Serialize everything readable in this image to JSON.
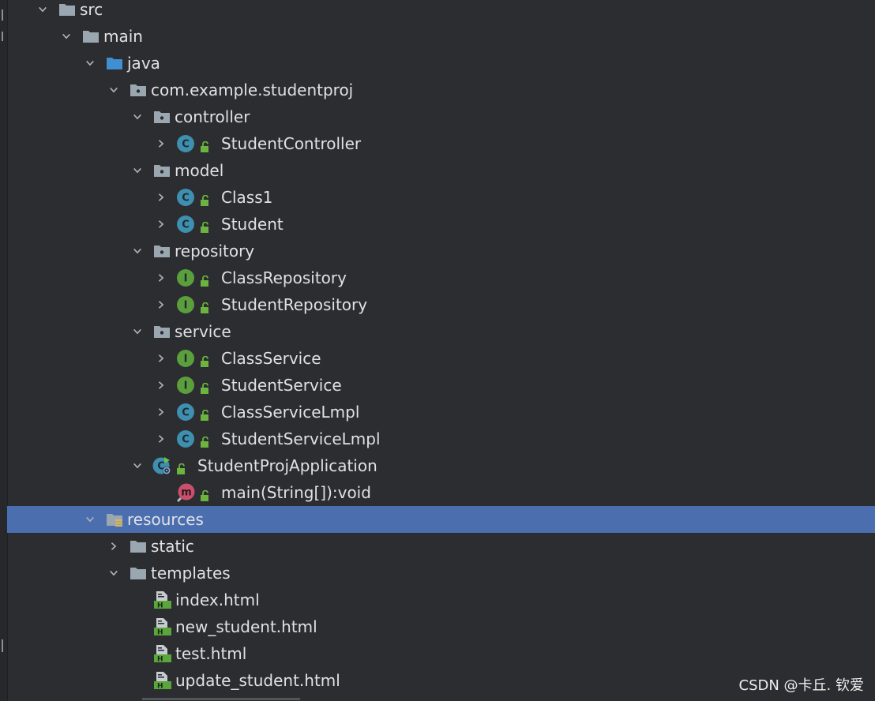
{
  "tree": {
    "nodes": [
      {
        "label": "src",
        "type": "folder",
        "expanded": true
      },
      {
        "label": "main",
        "type": "folder",
        "expanded": true
      },
      {
        "label": "java",
        "type": "source-folder",
        "expanded": true
      },
      {
        "label": "com.example.studentproj",
        "type": "package",
        "expanded": true
      },
      {
        "label": "controller",
        "type": "package",
        "expanded": true
      },
      {
        "label": "StudentController",
        "type": "class",
        "expanded": false
      },
      {
        "label": "model",
        "type": "package",
        "expanded": true
      },
      {
        "label": "Class1",
        "type": "class",
        "expanded": false
      },
      {
        "label": "Student",
        "type": "class",
        "expanded": false
      },
      {
        "label": "repository",
        "type": "package",
        "expanded": true
      },
      {
        "label": "ClassRepository",
        "type": "interface",
        "expanded": false
      },
      {
        "label": "StudentRepository",
        "type": "interface",
        "expanded": false
      },
      {
        "label": "service",
        "type": "package",
        "expanded": true
      },
      {
        "label": "ClassService",
        "type": "interface",
        "expanded": false
      },
      {
        "label": "StudentService",
        "type": "interface",
        "expanded": false
      },
      {
        "label": "ClassServiceLmpl",
        "type": "class",
        "expanded": false
      },
      {
        "label": "StudentServiceLmpl",
        "type": "class",
        "expanded": false
      },
      {
        "label": "StudentProjApplication",
        "type": "spring-app",
        "expanded": true
      },
      {
        "label": "main(String[]):void",
        "type": "method"
      },
      {
        "label": "resources",
        "type": "resources-folder",
        "expanded": true,
        "selected": true
      },
      {
        "label": "static",
        "type": "folder",
        "expanded": false
      },
      {
        "label": "templates",
        "type": "folder",
        "expanded": true
      },
      {
        "label": "index.html",
        "type": "html"
      },
      {
        "label": "new_student.html",
        "type": "html"
      },
      {
        "label": "test.html",
        "type": "html"
      },
      {
        "label": "update_student.html",
        "type": "html"
      }
    ]
  },
  "colors": {
    "background": "#2b2d30",
    "selection": "#4b6eaf",
    "folder": "#9aa7b0",
    "source_folder": "#3f8fd1",
    "class_icon": "#3e8fb0",
    "interface_icon": "#5b9e3c",
    "method_icon": "#c94f6d",
    "lock": "#6cb33f"
  },
  "watermark": "CSDN @卡丘. 钦爱"
}
